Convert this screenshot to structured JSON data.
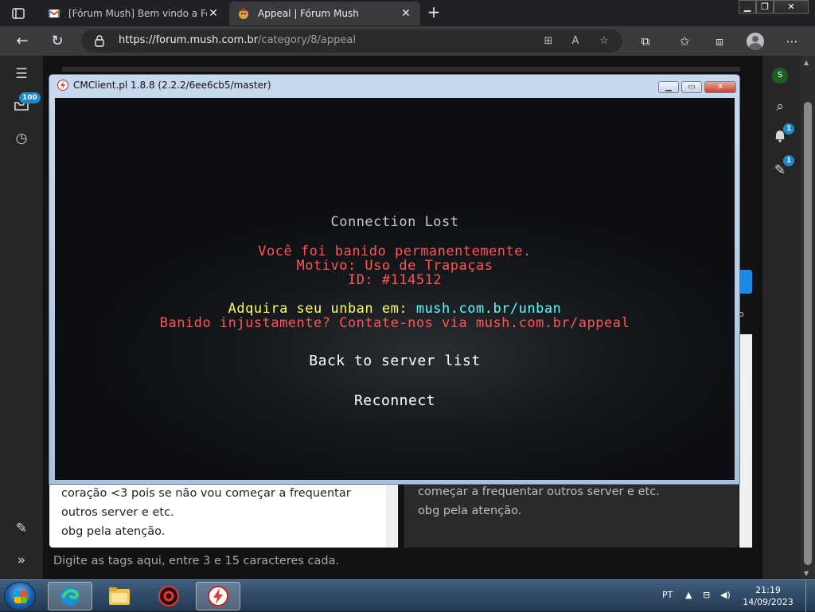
{
  "browser": {
    "tabs": [
      {
        "title": "[Fórum Mush] Bem vindo a Fórum Mush",
        "active": false
      },
      {
        "title": "Appeal | Fórum Mush",
        "active": true
      }
    ],
    "new_tab": "+",
    "url_host": "https://forum.mush.com.br",
    "url_path": "/category/8/appeal"
  },
  "forum": {
    "rail_badge": "100",
    "notification_badge": "1",
    "compose_badge": "1",
    "avatar_letter": "S",
    "editor_lines": [
      "coração <3 pois se não vou começar a frequentar",
      "outros server e etc.",
      "obg pela atenção."
    ],
    "preview_lines": [
      "começar a frequentar outros server e etc.",
      "obg pela atenção."
    ],
    "tags_placeholder": "Digite as tags aqui, entre 3 e 15 caracteres cada.",
    "side_fragment": "o"
  },
  "game_window": {
    "title": "CMClient.pl 1.8.8 (2.2.2/6ee6cb5/master)",
    "heading": "Connection Lost",
    "ban_line1": "Você foi banido permanentemente.",
    "ban_line2": "Motivo: Uso de Trapaças",
    "ban_line3": "ID: #114512",
    "unban_prefix": "Adquira seu unban em: ",
    "unban_link": "mush.com.br/unban",
    "appeal_line": "Banido injustamente? Contate-nos via mush.com.br/appeal",
    "back_button": "Back to server list",
    "reconnect_button": "Reconnect"
  },
  "taskbar": {
    "language": "PT",
    "time": "21:19",
    "date": "14/09/2023"
  },
  "colors": {
    "mc_red": "#ff5555",
    "mc_yellow": "#ffff55",
    "mc_aqua": "#55ffff",
    "accent_blue": "#1e88c9"
  }
}
